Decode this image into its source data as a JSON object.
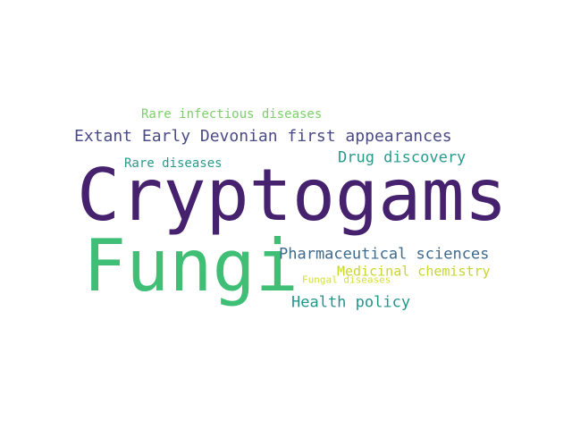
{
  "wordcloud": {
    "words": [
      {
        "id": "rare_infectious",
        "text": "Rare infectious diseases",
        "color": "#7ccf6a"
      },
      {
        "id": "extant",
        "text": "Extant Early Devonian first appearances",
        "color": "#4a4b86"
      },
      {
        "id": "drug",
        "text": "Drug discovery",
        "color": "#2a9a8c"
      },
      {
        "id": "rare",
        "text": "Rare diseases",
        "color": "#2a9a8c"
      },
      {
        "id": "cryptogams",
        "text": "Cryptogams",
        "color": "#46216e"
      },
      {
        "id": "fungi",
        "text": "Fungi",
        "color": "#3fbf76"
      },
      {
        "id": "pharma",
        "text": "Pharmaceutical sciences",
        "color": "#3e6a8c"
      },
      {
        "id": "medchem",
        "text": "Medicinal chemistry",
        "color": "#c9d62a"
      },
      {
        "id": "fungal",
        "text": "Fungal diseases",
        "color": "#d6e030"
      },
      {
        "id": "health",
        "text": "Health policy",
        "color": "#22958a"
      }
    ]
  }
}
